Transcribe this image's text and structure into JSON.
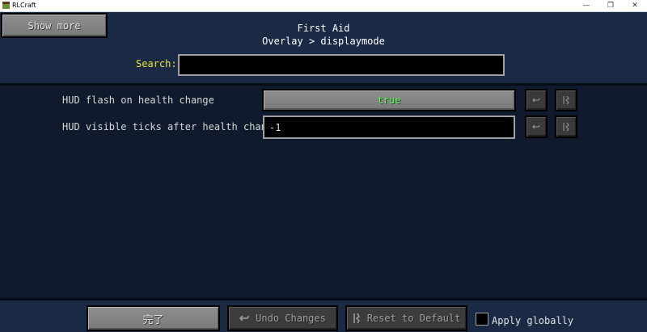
{
  "window": {
    "title": "RLCraft",
    "minimize": "—",
    "restore": "❐",
    "close": "✕"
  },
  "header": {
    "show_more": "Show more",
    "title": "First Aid",
    "breadcrumb": "Overlay > displaymode",
    "search_label": "Search:",
    "search_value": ""
  },
  "settings": [
    {
      "label": "HUD flash on health change",
      "value": "true",
      "value_color": "#55ff55"
    },
    {
      "label": "HUD visible ticks after health change",
      "value": "-1"
    }
  ],
  "footer": {
    "done": "完了",
    "undo": "Undo Changes",
    "reset": "Reset to Default",
    "apply_globally": "Apply globally"
  },
  "icons": {
    "undo": "undo-icon",
    "reset": "reset-icon"
  }
}
